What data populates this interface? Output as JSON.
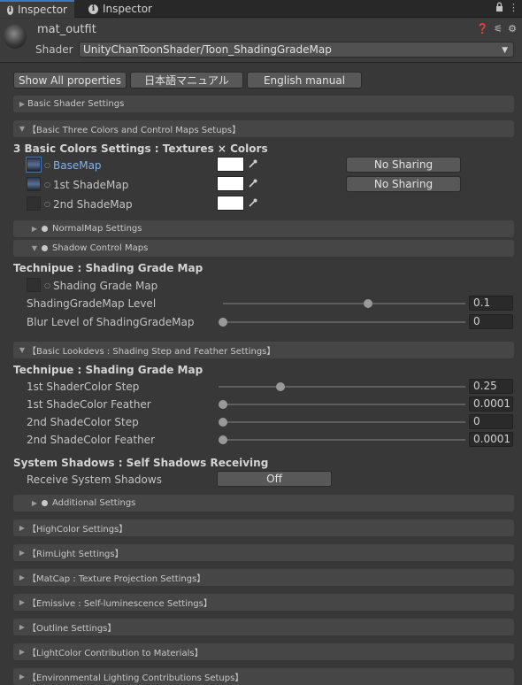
{
  "tabs": [
    {
      "label": "Inspector",
      "icon": "info-icon"
    },
    {
      "label": "Inspector",
      "icon": "info-icon"
    }
  ],
  "header": {
    "material_name": "mat_outfit",
    "shader_label": "Shader",
    "shader_value": "UnityChanToonShader/Toon_ShadingGradeMap"
  },
  "top_buttons": {
    "show_all": "Show All properties",
    "japanese_manual": "日本語マニュアル",
    "english_manual": "English manual"
  },
  "sections": {
    "basic_shader": "Basic Shader Settings",
    "three_colors": "【Basic Three Colors and Control Maps Setups】",
    "normal_map": "NormalMap Settings",
    "shadow_control": "Shadow Control Maps",
    "lookdevs": "【Basic Lookdevs : Shading Step and Feather Settings】",
    "additional": "Additional Settings",
    "highcolor": "【HighColor Settings】",
    "rimlight": "【RimLight Settings】",
    "matcap": "【MatCap : Texture Projection Settings】",
    "emissive": "【Emissive : Self-luminescence Settings】",
    "outline": "【Outline Settings】",
    "lightcolor": "【LightColor Contribution to Materials】",
    "environmental": "【Environmental Lighting Contributions Setups】"
  },
  "colors_heading": "3 Basic Colors Settings : Textures × Colors",
  "color_rows": [
    {
      "label": "BaseMap",
      "swatch": "#ffffff",
      "sharing": "No Sharing"
    },
    {
      "label": "1st ShadeMap",
      "swatch": "#ffffff",
      "sharing": "No Sharing"
    },
    {
      "label": "2nd ShadeMap",
      "swatch": "#ffffff",
      "sharing": ""
    }
  ],
  "shadow_heading": "Technipue : Shading Grade Map",
  "shading_grade_map_label": "Shading Grade Map",
  "shadow_sliders": [
    {
      "label": "ShadingGradeMap Level",
      "value": "0.1",
      "fraction": 0.6
    },
    {
      "label": "Blur Level of ShadingGradeMap",
      "value": "0",
      "fraction": 0.0
    }
  ],
  "lookdev_heading": "Technipue : Shading Grade Map",
  "lookdev_sliders": [
    {
      "label": "1st ShaderColor Step",
      "value": "0.25",
      "fraction": 0.25
    },
    {
      "label": "1st ShadeColor Feather",
      "value": "0.0001",
      "fraction": 0.0
    },
    {
      "label": "2nd ShadeColor Step",
      "value": "0",
      "fraction": 0.0
    },
    {
      "label": "2nd ShadeColor Feather",
      "value": "0.0001",
      "fraction": 0.0
    }
  ],
  "system_shadows_heading": "System Shadows : Self Shadows Receiving",
  "receive_shadows": {
    "label": "Receive System Shadows",
    "value": "Off"
  },
  "accent_color": "#3a79bb",
  "link_color": "#7fb2ef"
}
